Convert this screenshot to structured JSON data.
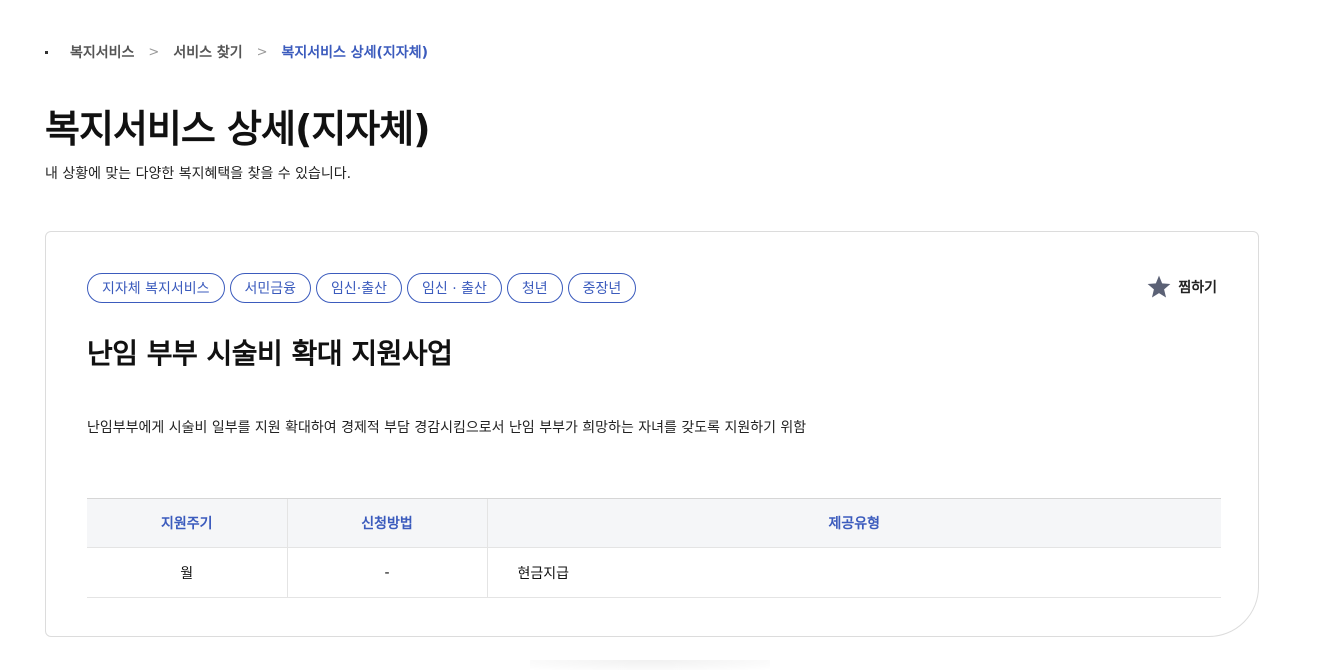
{
  "breadcrumb": {
    "items": [
      "복지서비스",
      "서비스 찾기"
    ],
    "current": "복지서비스 상세(지자체)",
    "separator": ">"
  },
  "page": {
    "title": "복지서비스 상세(지자체)",
    "subtitle": "내 상황에 맞는 다양한 복지혜택을 찾을 수 있습니다."
  },
  "service": {
    "tags": [
      "지자체 복지서비스",
      "서민금융",
      "임신·출산",
      "임신 · 출산",
      "청년",
      "중장년"
    ],
    "favorite_label": "찜하기",
    "favorite_icon": "star-icon",
    "title": "난임 부부 시술비 확대 지원사업",
    "description": "난임부부에게 시술비 일부를 지원 확대하여 경제적 부담 경감시킴으로서 난임 부부가 희망하는 자녀를 갖도록 지원하기 위함",
    "table": {
      "headers": [
        "지원주기",
        "신청방법",
        "제공유형"
      ],
      "row": [
        "월",
        "-",
        "현금지급"
      ]
    }
  },
  "colors": {
    "accent": "#3b5bbd",
    "star": "#5b6175",
    "table_header_bg": "#f5f6f8"
  }
}
